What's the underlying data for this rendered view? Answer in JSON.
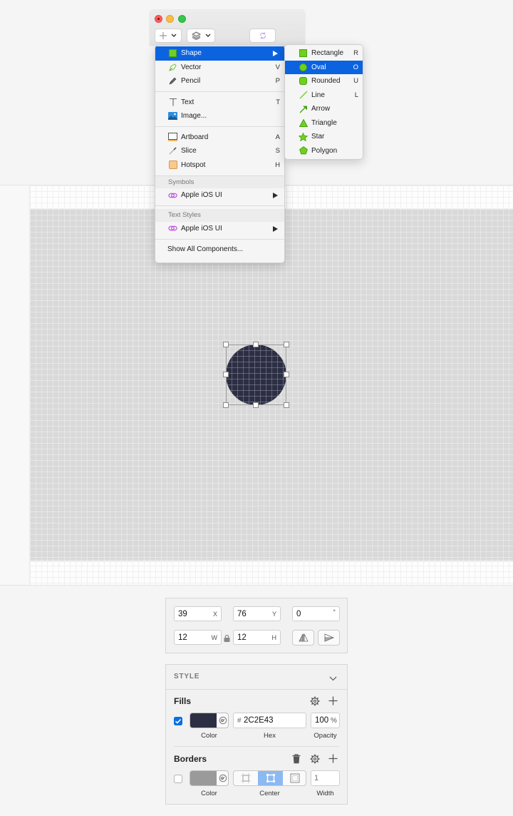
{
  "insert_menu": {
    "items": [
      {
        "label": "Shape",
        "key": "",
        "icon": "shape-square-icon",
        "highlighted": true,
        "submenu": true
      },
      {
        "label": "Vector",
        "key": "V",
        "icon": "vector-pen-icon"
      },
      {
        "label": "Pencil",
        "key": "P",
        "icon": "pencil-icon"
      },
      {
        "label": "Text",
        "key": "T",
        "icon": "text-cursor-icon"
      },
      {
        "label": "Image...",
        "key": "",
        "icon": "image-icon"
      },
      {
        "label": "Artboard",
        "key": "A",
        "icon": "artboard-icon"
      },
      {
        "label": "Slice",
        "key": "S",
        "icon": "slice-knife-icon"
      },
      {
        "label": "Hotspot",
        "key": "H",
        "icon": "hotspot-icon"
      }
    ],
    "symbols_header": "Symbols",
    "symbols_item": "Apple iOS UI",
    "text_styles_header": "Text Styles",
    "text_styles_item": "Apple iOS UI",
    "show_all": "Show All Components..."
  },
  "shape_submenu": {
    "items": [
      {
        "label": "Rectangle",
        "key": "R",
        "icon": "rectangle-icon"
      },
      {
        "label": "Oval",
        "key": "O",
        "icon": "oval-icon",
        "highlighted": true
      },
      {
        "label": "Rounded",
        "key": "U",
        "icon": "rounded-rect-icon"
      },
      {
        "label": "Line",
        "key": "L",
        "icon": "line-icon"
      },
      {
        "label": "Arrow",
        "key": "",
        "icon": "arrow-icon"
      },
      {
        "label": "Triangle",
        "key": "",
        "icon": "triangle-icon"
      },
      {
        "label": "Star",
        "key": "",
        "icon": "star-icon"
      },
      {
        "label": "Polygon",
        "key": "",
        "icon": "polygon-icon"
      }
    ]
  },
  "inspector": {
    "x": "39",
    "x_label": "X",
    "y": "76",
    "y_label": "Y",
    "rotation": "0",
    "rotation_unit": "°",
    "w": "12",
    "w_label": "W",
    "h": "12",
    "h_label": "H"
  },
  "style": {
    "title": "STYLE",
    "fills": {
      "title": "Fills",
      "enabled": true,
      "color": "#2C2E43",
      "hex_prefix": "#",
      "hex": "2C2E43",
      "opacity": "100",
      "opacity_unit": "%",
      "color_label": "Color",
      "hex_label": "Hex",
      "opacity_label": "Opacity"
    },
    "borders": {
      "title": "Borders",
      "enabled": false,
      "color": "#9a9a9a",
      "width_placeholder": "1",
      "color_label": "Color",
      "position_label": "Center",
      "width_label": "Width"
    }
  },
  "colors": {
    "accent": "#0b63e0",
    "oval_fill": "#2C2E43",
    "shape_green": "#6ed11e"
  }
}
